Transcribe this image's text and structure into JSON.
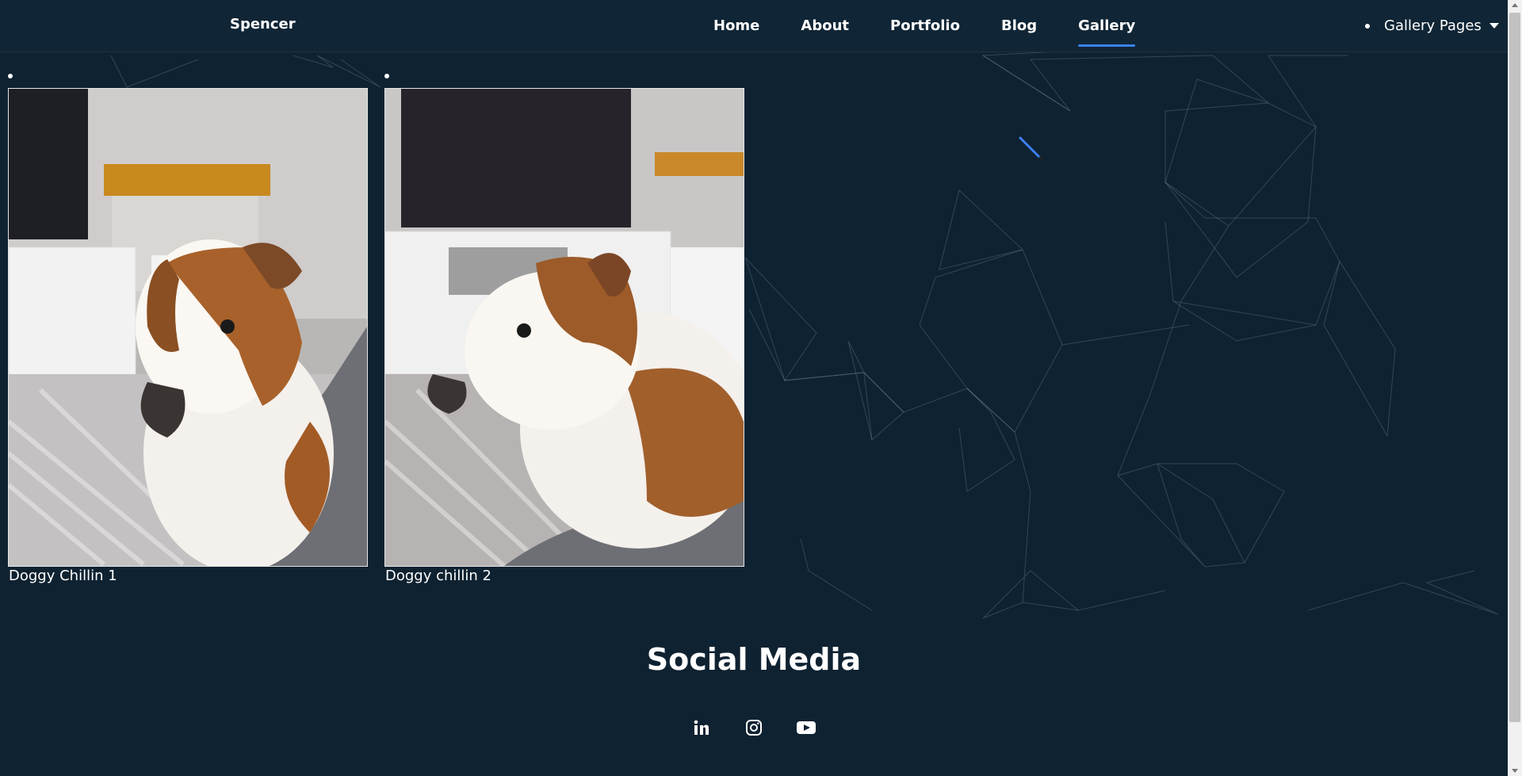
{
  "brand": "Spencer",
  "nav": {
    "items": [
      {
        "label": "Home",
        "active": false
      },
      {
        "label": "About",
        "active": false
      },
      {
        "label": "Portfolio",
        "active": false
      },
      {
        "label": "Blog",
        "active": false
      },
      {
        "label": "Gallery",
        "active": true
      }
    ],
    "gallery_pages": "Gallery Pages"
  },
  "gallery": {
    "items": [
      {
        "caption": "Doggy Chillin 1"
      },
      {
        "caption": "Doggy chillin 2"
      }
    ]
  },
  "social": {
    "title": "Social Media",
    "icons": [
      "linkedin-icon",
      "instagram-icon",
      "youtube-icon"
    ]
  },
  "colors": {
    "background": "#0f2231",
    "accent": "#3b82f6"
  }
}
